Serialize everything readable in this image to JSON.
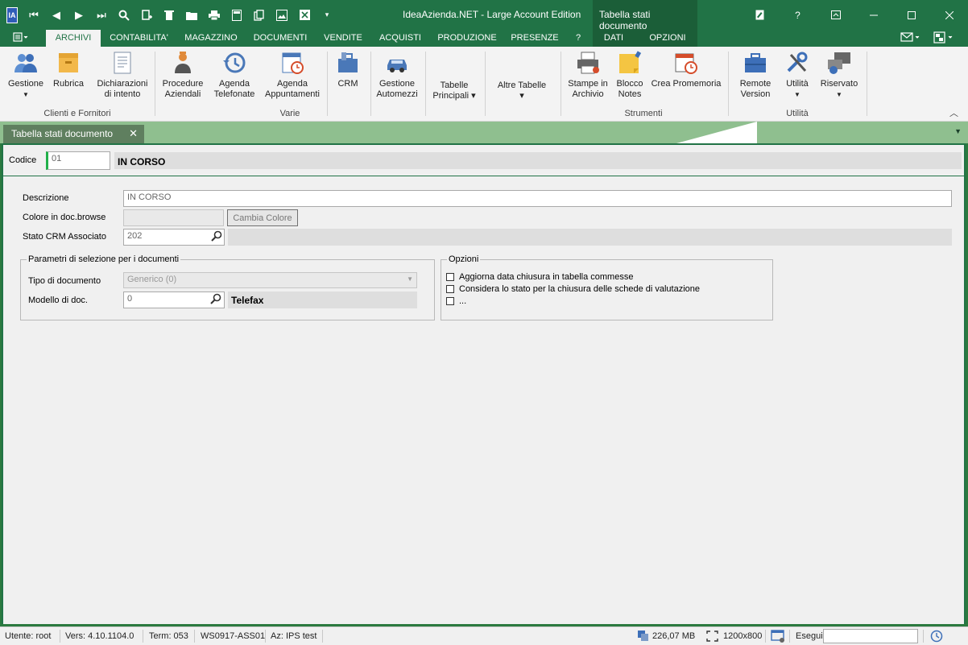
{
  "titlebar": {
    "title": "IdeaAzienda.NET - Large Account Edition",
    "context_title": "Tabella stati documento",
    "help": "?",
    "logo": "IA"
  },
  "menu": {
    "tabs": [
      "ARCHIVI",
      "CONTABILITA'",
      "MAGAZZINO",
      "DOCUMENTI",
      "VENDITE",
      "ACQUISTI",
      "PRODUZIONE",
      "PRESENZE",
      "?",
      "DATI",
      "OPZIONI"
    ],
    "active": "ARCHIVI"
  },
  "ribbon": {
    "buttons": {
      "gestione": "Gestione",
      "rubrica": "Rubrica",
      "dichiarazioni": "Dichiarazioni di intento",
      "procedure": "Procedure Aziendali",
      "agenda_tel": "Agenda Telefonate",
      "agenda_app": "Agenda Appuntamenti",
      "crm": "CRM",
      "automezzi": "Gestione Automezzi",
      "tabelle_principali": "Tabelle Principali",
      "altre_tabelle": "Altre Tabelle",
      "stampe": "Stampe in Archivio",
      "blocco": "Blocco Notes",
      "promemoria": "Crea Promemoria",
      "remote": "Remote Version",
      "utilita": "Utilità",
      "riservato": "Riservato"
    },
    "groups": {
      "clienti": "Clienti e Fornitori",
      "varie": "Varie",
      "strumenti": "Strumenti",
      "utilita": "Utilità"
    }
  },
  "doc_tab": {
    "label": "Tabella stati documento"
  },
  "header": {
    "codice_label": "Codice",
    "codice_value": "01",
    "codice_desc": "IN CORSO"
  },
  "form": {
    "descrizione_label": "Descrizione",
    "descrizione_value": "IN CORSO",
    "colore_label": "Colore in doc.browse",
    "cambia_colore": "Cambia Colore",
    "stato_crm_label": "Stato CRM Associato",
    "stato_crm_value": "202",
    "parametri_title": "Parametri di selezione per i documenti",
    "tipo_doc_label": "Tipo di documento",
    "tipo_doc_value": "Generico (0)",
    "modello_label": "Modello di doc.",
    "modello_value": "0",
    "modello_desc": "Telefax",
    "opzioni_title": "Opzioni",
    "options": [
      "Aggiorna data chiusura in tabella commesse",
      "Considera lo stato per la chiusura delle schede di valutazione",
      "..."
    ]
  },
  "status": {
    "utente": "Utente: root",
    "versione": "Vers: 4.10.1104.0",
    "term": "Term: 053",
    "ws": "WS0917-ASS01",
    "azienda": "Az: IPS test",
    "memory": "226,07 MB",
    "resolution": "1200x800",
    "esegui_label": "Esegui"
  },
  "colors": {
    "accent": "#217346",
    "context": "#1b5e38",
    "strip": "#8fbf8f"
  }
}
